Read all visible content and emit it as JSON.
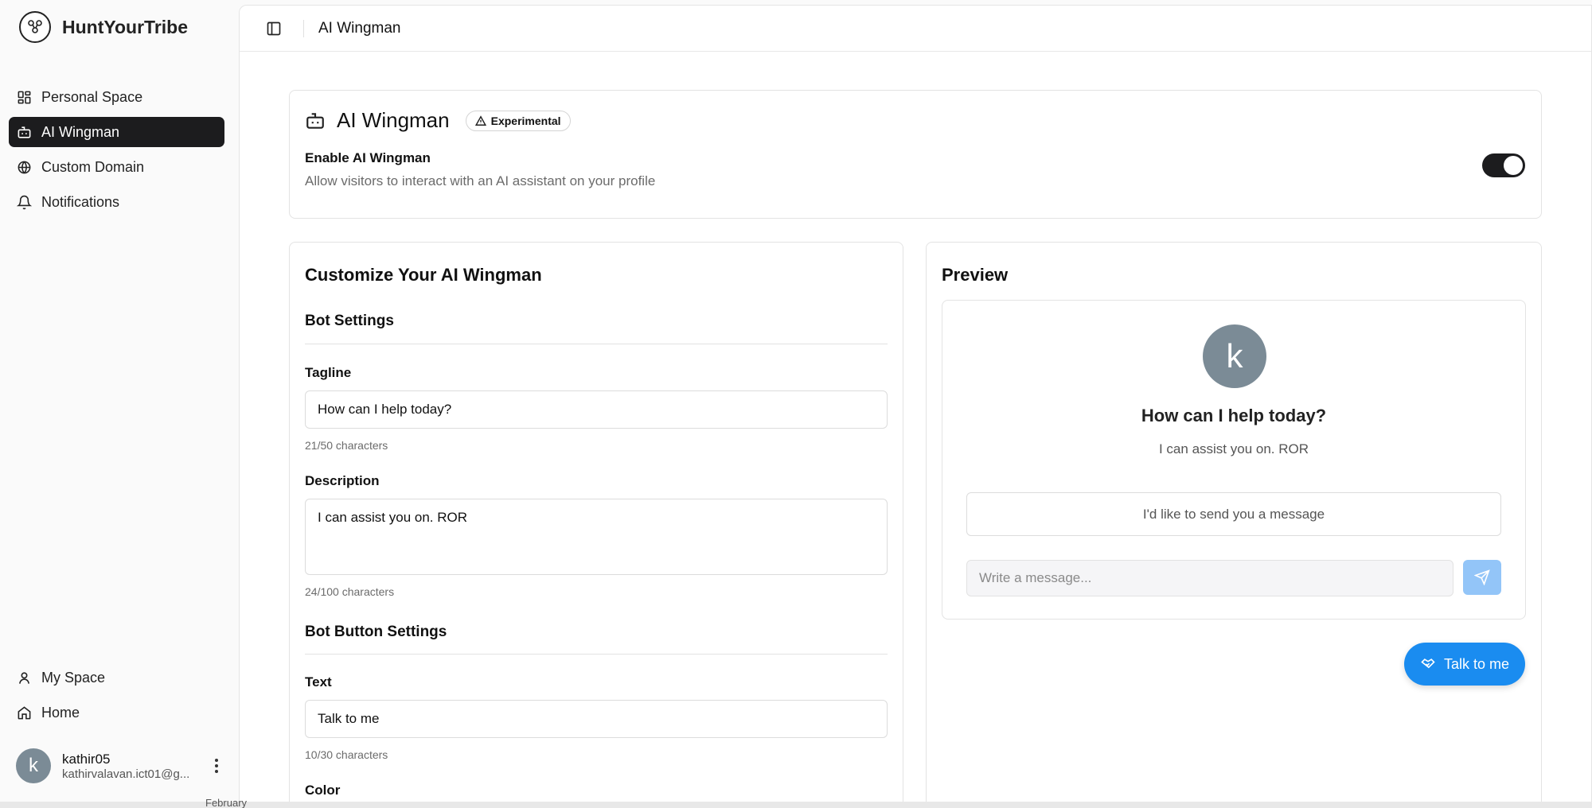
{
  "app": {
    "name": "HuntYourTribe"
  },
  "sidebar": {
    "items": [
      {
        "label": "Personal Space",
        "icon": "layout-grid-icon"
      },
      {
        "label": "AI Wingman",
        "icon": "bot-icon",
        "active": true
      },
      {
        "label": "Custom Domain",
        "icon": "globe-icon"
      },
      {
        "label": "Notifications",
        "icon": "bell-icon"
      }
    ],
    "bottom_items": [
      {
        "label": "My Space",
        "icon": "user-icon"
      },
      {
        "label": "Home",
        "icon": "home-icon"
      }
    ],
    "user": {
      "initial": "k",
      "name": "kathir05",
      "email": "kathirvalavan.ict01@g..."
    }
  },
  "header": {
    "title": "AI Wingman"
  },
  "enable_card": {
    "title": "AI Wingman",
    "badge": "Experimental",
    "label": "Enable AI Wingman",
    "description": "Allow visitors to interact with an AI assistant on your profile",
    "enabled": true
  },
  "customize": {
    "title": "Customize Your AI Wingman",
    "bot_settings": "Bot Settings",
    "tagline_label": "Tagline",
    "tagline_value": "How can I help today?",
    "tagline_count": "21/50 characters",
    "description_label": "Description",
    "description_value": "I can assist you on. ROR",
    "description_count": "24/100 characters",
    "button_settings": "Bot Button Settings",
    "text_label": "Text",
    "text_value": "Talk to me",
    "text_count": "10/30 characters",
    "color_label": "Color"
  },
  "preview": {
    "title": "Preview",
    "avatar_initial": "k",
    "tagline": "How can I help today?",
    "description": "I can assist you on. ROR",
    "suggestion": "I'd like to send you a message",
    "input_placeholder": "Write a message...",
    "button_text": "Talk to me"
  },
  "footer": {
    "partial_text": "February"
  },
  "colors": {
    "accent": "#1a8cf0",
    "active_nav": "#1c1c1e",
    "avatar": "#7b8b96"
  }
}
